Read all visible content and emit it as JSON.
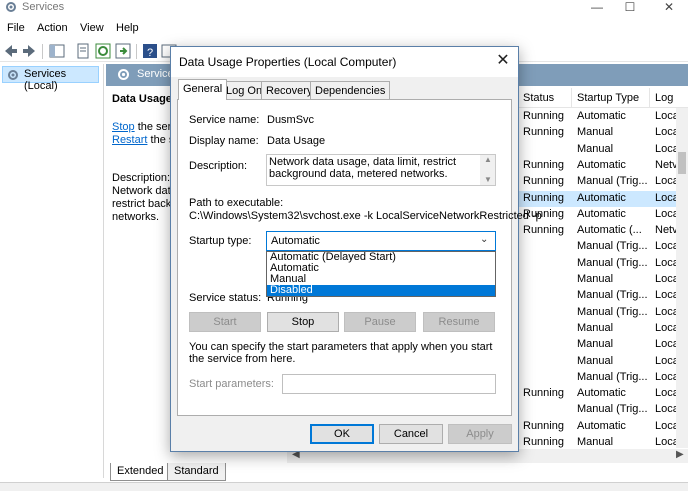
{
  "window": {
    "title": "Services",
    "minimize_icon": "minimize-icon",
    "maximize_icon": "maximize-icon",
    "close_icon": "close-icon"
  },
  "menu": [
    "File",
    "Action",
    "View",
    "Help"
  ],
  "tree": {
    "label": "Services (Local)"
  },
  "content_header": {
    "title": "Service"
  },
  "detail": {
    "service_name": "Data Usage",
    "stop_link": "Stop",
    "stop_rest": " the serv",
    "restart_link": "Restart",
    "restart_rest": " the se",
    "desc_lines": [
      "Description:",
      "Network data",
      "restrict backg",
      "networks."
    ]
  },
  "list": {
    "headers": [
      "Status",
      "Startup Type",
      "Log"
    ],
    "rows": [
      [
        "Running",
        "Automatic",
        "Loca"
      ],
      [
        "Running",
        "Manual",
        "Loca"
      ],
      [
        "",
        "Manual",
        "Loca"
      ],
      [
        "Running",
        "Automatic",
        "Netv"
      ],
      [
        "Running",
        "Manual (Trig...",
        "Loca"
      ],
      [
        "Running",
        "Automatic",
        "Loca"
      ],
      [
        "Running",
        "Automatic",
        "Loca"
      ],
      [
        "Running",
        "Automatic (...",
        "Netv"
      ],
      [
        "",
        "Manual (Trig...",
        "Loca"
      ],
      [
        "",
        "Manual (Trig...",
        "Loca"
      ],
      [
        "",
        "Manual",
        "Loca"
      ],
      [
        "",
        "Manual (Trig...",
        "Loca"
      ],
      [
        "",
        "Manual (Trig...",
        "Loca"
      ],
      [
        "",
        "Manual",
        "Loca"
      ],
      [
        "",
        "Manual",
        "Loca"
      ],
      [
        "",
        "Manual",
        "Loca"
      ],
      [
        "",
        "Manual (Trig...",
        "Loca"
      ],
      [
        "Running",
        "Automatic",
        "Loca"
      ],
      [
        "",
        "Manual (Trig...",
        "Loca"
      ],
      [
        "Running",
        "Automatic",
        "Loca"
      ],
      [
        "Running",
        "Manual",
        "Loca"
      ]
    ],
    "selected_row": 5
  },
  "bottom_tabs": [
    "Extended",
    "Standard"
  ],
  "dialog": {
    "title": "Data Usage Properties (Local Computer)",
    "tabs": [
      "General",
      "Log On",
      "Recovery",
      "Dependencies"
    ],
    "service_name_label": "Service name:",
    "service_name_value": "DusmSvc",
    "display_name_label": "Display name:",
    "display_name_value": "Data Usage",
    "description_label": "Description:",
    "description_value": "Network data usage, data limit, restrict background data, metered networks.",
    "path_label": "Path to executable:",
    "path_value": "C:\\Windows\\System32\\svchost.exe -k LocalServiceNetworkRestricted -p",
    "startup_type_label": "Startup type:",
    "startup_type_value": "Automatic",
    "startup_options": [
      "Automatic (Delayed Start)",
      "Automatic",
      "Manual",
      "Disabled"
    ],
    "highlighted_option": "Disabled",
    "status_label": "Service status:",
    "status_value": "Running",
    "buttons": {
      "start": "Start",
      "stop": "Stop",
      "pause": "Pause",
      "resume": "Resume"
    },
    "hint": "You can specify the start parameters that apply when you start the service from here.",
    "params_label": "Start parameters:",
    "params_value": "",
    "ok": "OK",
    "cancel": "Cancel",
    "apply": "Apply"
  },
  "colors": {
    "accent": "#0078d7",
    "selection": "#cce8ff",
    "header_bar": "#7f9db9",
    "link": "#0066cc"
  }
}
